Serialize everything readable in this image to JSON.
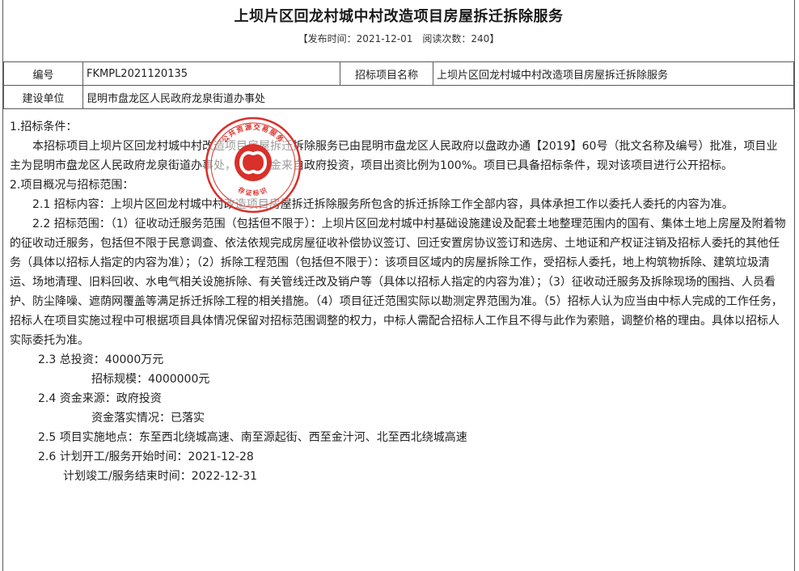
{
  "header": {
    "title": "上坝片区回龙村城中村改造项目房屋拆迁拆除服务",
    "publish_info": "【发布时间：2021-12-01　阅读次数：240】"
  },
  "info_table": {
    "code_label": "编号",
    "code_value": "FKMPL2021120135",
    "project_label": "招标项目名称",
    "project_value": "上坝片区回龙村城中村改造项目房屋拆迁拆除服务",
    "builder_label": "建设单位",
    "builder_value": "昆明市盘龙区人民政府龙泉街道办事处"
  },
  "seal": {
    "arc_text": "公共资源交易服务",
    "bottom_text": "存证标识",
    "color": "#d9302a"
  },
  "content": {
    "s1_heading": "1.招标条件：",
    "s1_para": "本招标项目上坝片区回龙村城中村改造项目房屋拆迁拆除服务已由昆明市盘龙区人民政府以盘政办通【2019】60号（批文名称及编号）批准，项目业主为昆明市盘龙区人民政府龙泉街道办事处，建设资金来自政府投资，项目出资比例为100%。项目已具备招标条件，现对该项目进行公开招标。",
    "s2_heading": "2.项目概况与招标范围：",
    "s2_1": "2.1 招标内容：上坝片区回龙村城中村改造项目房屋拆迁拆除服务所包含的拆迁拆除工作全部内容，具体承担工作以委托人委托的内容为准。",
    "s2_2": "2.2 招标范围：（1）征收动迁服务范围（包括但不限于）：上坝片区回龙村城中村基础设施建设及配套土地整理范围内的国有、集体土地上房屋及附着物的征收动迁服务，包括但不限于民意调查、依法依规完成房屋征收补偿协议签订、回迁安置房协议签订和选房、土地证和产权证注销及招标人委托的其他任务（具体以招标人指定的内容为准）；（2）拆除工程范围（包括但不限于）：该项目区域内的房屋拆除工作，受招标人委托，地上构筑物拆除、建筑垃圾清运、场地清理、旧料回收、水电气相关设施拆除、有关管线迁改及销户等（具体以招标人指定的内容为准）；（3）征收动迁服务及拆除现场的围挡、人员看护、防尘降噪、遮荫网覆盖等满足拆迁拆除工程的相关措施。（4）项目征迁范围实际以勘测定界范围为准。（5）招标人认为应当由中标人完成的工作任务，招标人在项目实施过程中可根据项目具体情况保留对招标范围调整的权力，中标人需配合招标人工作且不得与此作为索赔，调整价格的理由。具体以招标人实际委托为准。",
    "s2_3": "2.3 总投资：40000万元",
    "s2_3_scale": "招标规模：4000000元",
    "s2_4": "2.4 资金来源：政府投资",
    "s2_4_status": "资金落实情况：已落实",
    "s2_5": "2.5 项目实施地点：东至西北绕城高速、南至源起街、西至金汁河、北至西北绕城高速",
    "s2_6": "2.6 计划开工/服务开始时间：2021-12-28",
    "s2_6_end": "计划竣工/服务结束时间：2022-12-31"
  }
}
